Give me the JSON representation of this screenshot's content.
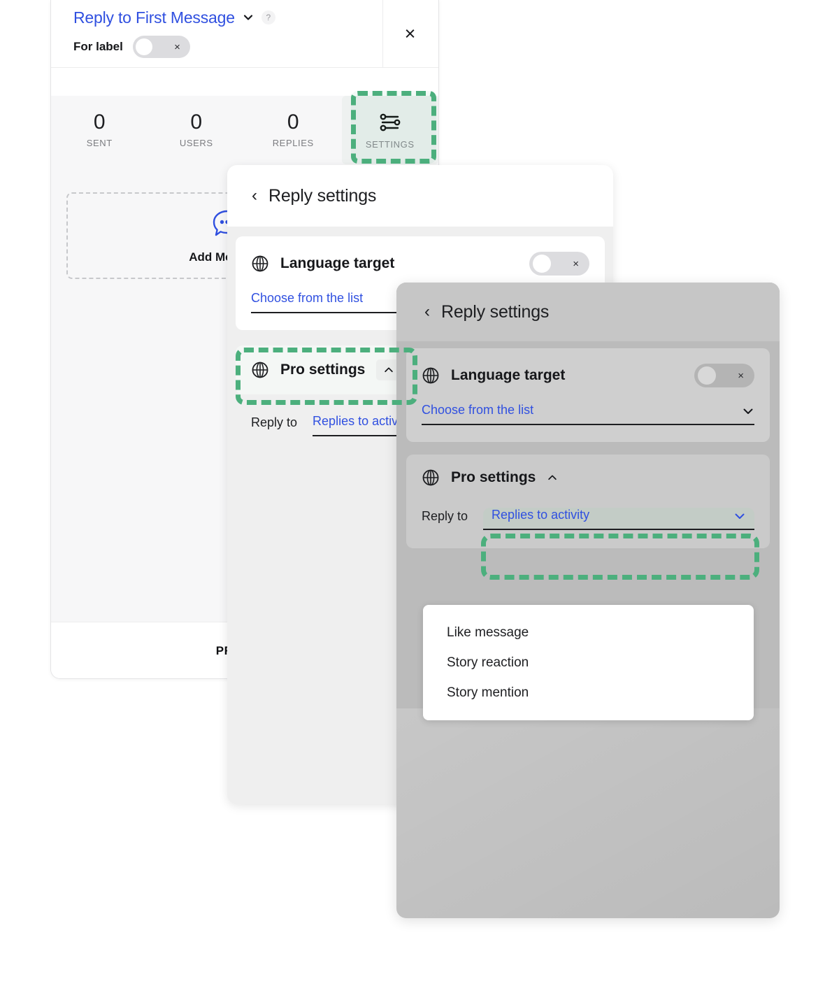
{
  "left_panel": {
    "campaign_title": "Reply to First Message",
    "title_chevron_icon": "chevron-down-icon",
    "help_badge": "?",
    "for_label": "For label",
    "for_label_toggle_state": "off",
    "for_label_toggle_x": "×",
    "close_icon": "×",
    "stats": [
      {
        "value": "0",
        "label": "SENT"
      },
      {
        "value": "0",
        "label": "USERS"
      },
      {
        "value": "0",
        "label": "REPLIES"
      }
    ],
    "settings_tab": {
      "label": "SETTINGS",
      "icon": "sliders-icon",
      "highlighted": true
    },
    "add_message": {
      "label": "Add Message",
      "icon": "chat-bubble-dots-icon"
    },
    "footer_button": "PREVIEW"
  },
  "mid_panel": {
    "back_icon": "‹",
    "header_title": "Reply settings",
    "language_card": {
      "icon": "globe-icon",
      "title": "Language target",
      "toggle_state": "off",
      "toggle_x": "×",
      "select_value": "Choose from the list",
      "select_chevron_icon": "chevron-down-icon"
    },
    "pro_card": {
      "icon": "globe-icon",
      "title": "Pro settings",
      "collapse_icon": "chevron-up-icon",
      "highlighted": true
    },
    "reply_to": {
      "label": "Reply to",
      "value": "Replies to activity",
      "chevron_icon": "chevron-down-icon"
    }
  },
  "right_panel": {
    "back_icon": "‹",
    "header_title": "Reply settings",
    "language_card": {
      "icon": "globe-icon",
      "title": "Language target",
      "toggle_state": "off",
      "toggle_x": "×",
      "select_value": "Choose from the list",
      "select_chevron_icon": "chevron-down-icon"
    },
    "pro_card": {
      "icon": "globe-icon",
      "title": "Pro settings",
      "collapse_icon": "chevron-up-icon"
    },
    "reply_to": {
      "label": "Reply to",
      "value": "Replies to activity",
      "chevron_icon": "chevron-down-icon",
      "highlighted": true
    },
    "dropdown_options": [
      "Like message",
      "Story reaction",
      "Story mention"
    ]
  },
  "colors": {
    "accent_blue": "#3050e0",
    "highlight_green": "#4caf7d",
    "panel_gray": "#f7f7f8",
    "dim_gray": "#bbbbbb"
  }
}
